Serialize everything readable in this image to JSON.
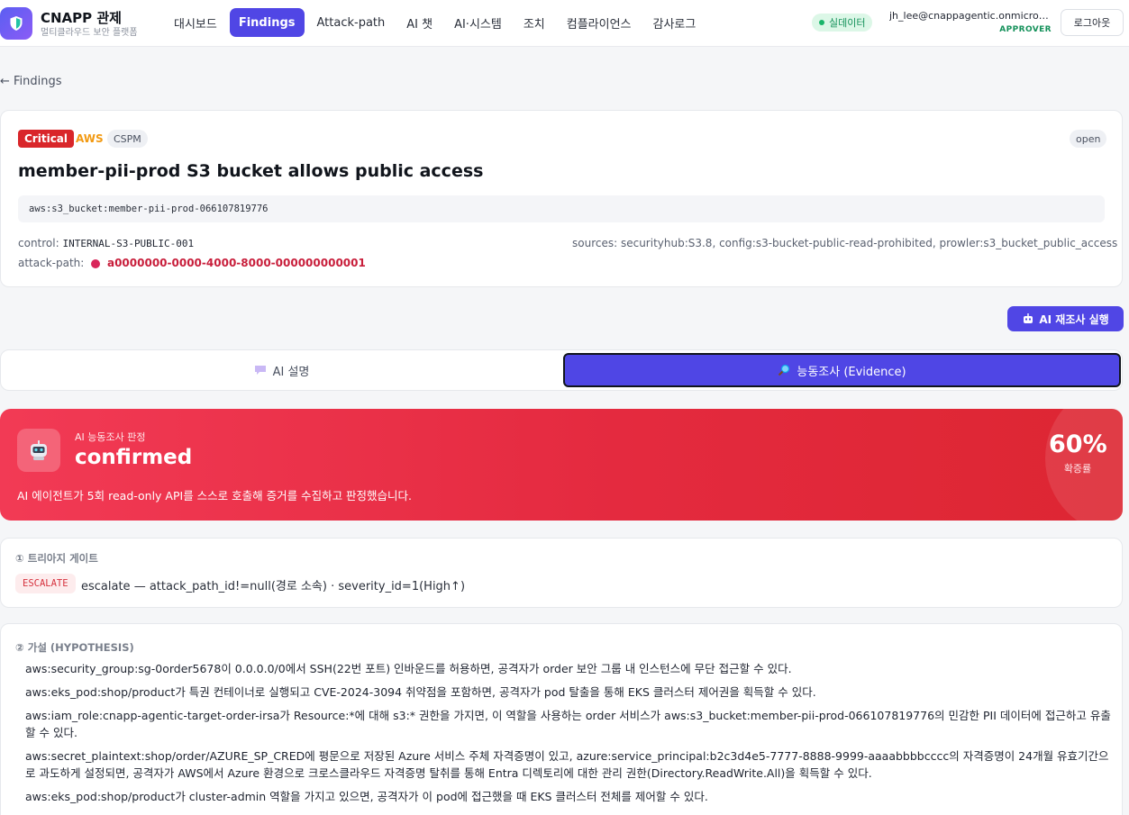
{
  "header": {
    "brand_name": "CNAPP 관제",
    "brand_sub": "멀티클라우드 보안 플랫폼",
    "nav": [
      {
        "label": "대시보드",
        "active": false
      },
      {
        "label": "Findings",
        "active": true
      },
      {
        "label": "Attack-path",
        "active": false
      },
      {
        "label": "AI 챗",
        "active": false
      },
      {
        "label": "AI·시스템",
        "active": false
      },
      {
        "label": "조치",
        "active": false
      },
      {
        "label": "컴플라이언스",
        "active": false
      },
      {
        "label": "감사로그",
        "active": false
      }
    ],
    "live_label": "실데이터",
    "user_email": "jh_lee@cnappagentic.onmicrosoft.com",
    "user_role": "APPROVER",
    "logout_label": "로그아웃"
  },
  "back_link": "← Findings",
  "finding": {
    "severity": "Critical",
    "provider": "AWS",
    "category": "CSPM",
    "status": "open",
    "title": "member-pii-prod S3 bucket allows public access",
    "resource": "aws:s3_bucket:member-pii-prod-066107819776",
    "control_label": "control:",
    "control_value": "INTERNAL-S3-PUBLIC-001",
    "sources_text": "sources: securityhub:S3.8, config:s3-bucket-public-read-prohibited, prowler:s3_bucket_public_access",
    "attack_path_label": "attack-path:",
    "attack_path_id": "a0000000-0000-4000-8000-000000000001"
  },
  "rerun_button": "AI 재조사 실행",
  "tabs": {
    "ai_label": "AI 설명",
    "evidence_label": "능동조사 (Evidence)"
  },
  "verdict": {
    "kicker": "AI 능동조사 판정",
    "value": "confirmed",
    "desc": "AI 에이전트가 5회 read-only API를 스스로 호출해 증거를 수집하고 판정했습니다.",
    "confidence": "60%",
    "confidence_label": "확증률"
  },
  "triage": {
    "heading": "① 트리아지 게이트",
    "badge": "ESCALATE",
    "text": "escalate — attack_path_id!=null(경로 소속) · severity_id=1(High↑)"
  },
  "hypothesis": {
    "heading": "② 가설 (HYPOTHESIS)",
    "items": [
      "aws:security_group:sg-0order5678이 0.0.0.0/0에서 SSH(22번 포트) 인바운드를 허용하면, 공격자가 order 보안 그룹 내 인스턴스에 무단 접근할 수 있다.",
      "aws:eks_pod:shop/product가 특권 컨테이너로 실행되고 CVE-2024-3094 취약점을 포함하면, 공격자가 pod 탈출을 통해 EKS 클러스터 제어권을 획득할 수 있다.",
      "aws:iam_role:cnapp-agentic-target-order-irsa가 Resource:*에 대해 s3:* 권한을 가지면, 이 역할을 사용하는 order 서비스가 aws:s3_bucket:member-pii-prod-066107819776의 민감한 PII 데이터에 접근하고 유출할 수 있다.",
      "aws:secret_plaintext:shop/order/AZURE_SP_CRED에 평문으로 저장된 Azure 서비스 주체 자격증명이 있고, azure:service_principal:b2c3d4e5-7777-8888-9999-aaaabbbbcccc의 자격증명이 24개월 유효기간으로 과도하게 설정되면, 공격자가 AWS에서 Azure 환경으로 크로스클라우드 자격증명 탈취를 통해 Entra 디렉토리에 대한 관리 권한(Directory.ReadWrite.All)을 획득할 수 있다.",
      "aws:eks_pod:shop/product가 cluster-admin 역할을 가지고 있으면, 공격자가 이 pod에 접근했을 때 EKS 클러스터 전체를 제어할 수 있다."
    ]
  }
}
